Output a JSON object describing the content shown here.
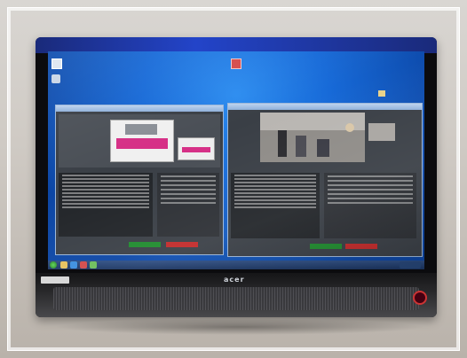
{
  "monitor": {
    "brand_text": "acer"
  },
  "desktop_icons": [
    "computer-icon",
    "recycle-bin-icon",
    "app-shortcut-icon",
    "folder-icon"
  ],
  "windows": [
    {
      "name": "left-application-window",
      "active": false
    },
    {
      "name": "right-application-window",
      "active": true
    }
  ],
  "colors": {
    "wallpaper": "#176ad8",
    "window_frame": "#9bb6d8",
    "start_button": "#1f8b2e",
    "stop_button": "#c22a2a",
    "power_led": "#cc3333"
  }
}
